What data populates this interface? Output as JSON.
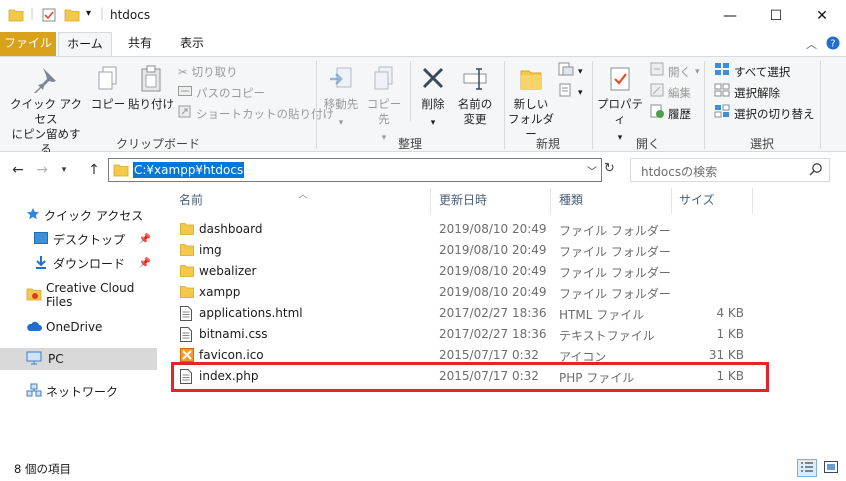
{
  "window": {
    "title": "htdocs",
    "minimize_glyph": "—",
    "maximize_glyph": "☐",
    "close_glyph": "✕"
  },
  "tabs": [
    "ファイル",
    "ホーム",
    "共有",
    "表示"
  ],
  "ribbon": {
    "clipboard": {
      "pin_label_line1": "クイック アクセス",
      "pin_label_line2": "にピン留めする",
      "copy": "コピー",
      "paste": "貼り付け",
      "cut": "切り取り",
      "copy_path": "パスのコピー",
      "paste_shortcut": "ショートカットの貼り付け",
      "group_label": "クリップボード"
    },
    "organize": {
      "move_to": "移動先",
      "copy_to": "コピー先",
      "delete": "削除",
      "rename_line1": "名前の",
      "rename_line2": "変更",
      "group_label": "整理"
    },
    "new": {
      "new_folder_line1": "新しい",
      "new_folder_line2": "フォルダー",
      "group_label": "新規"
    },
    "open": {
      "properties": "プロパティ",
      "open": "開く",
      "edit": "編集",
      "history": "履歴",
      "group_label": "開く"
    },
    "select": {
      "select_all": "すべて選択",
      "select_none": "選択解除",
      "invert": "選択の切り替え",
      "group_label": "選択"
    }
  },
  "address": {
    "path": "C:¥xampp¥htdocs",
    "search_placeholder": "htdocsの検索"
  },
  "nav": {
    "quick_access": "クイック アクセス",
    "desktop": "デスクトップ",
    "downloads": "ダウンロード",
    "creative_cloud": "Creative Cloud Files",
    "onedrive": "OneDrive",
    "pc": "PC",
    "network": "ネットワーク"
  },
  "columns": {
    "name": "名前",
    "date": "更新日時",
    "type": "種類",
    "size": "サイズ"
  },
  "files": [
    {
      "name": "dashboard",
      "date": "2019/08/10 20:49",
      "type": "ファイル フォルダー",
      "size": "",
      "icon": "folder-icon"
    },
    {
      "name": "img",
      "date": "2019/08/10 20:49",
      "type": "ファイル フォルダー",
      "size": "",
      "icon": "folder-icon"
    },
    {
      "name": "webalizer",
      "date": "2019/08/10 20:49",
      "type": "ファイル フォルダー",
      "size": "",
      "icon": "folder-icon"
    },
    {
      "name": "xampp",
      "date": "2019/08/10 20:49",
      "type": "ファイル フォルダー",
      "size": "",
      "icon": "folder-icon"
    },
    {
      "name": "applications.html",
      "date": "2017/02/27 18:36",
      "type": "HTML ファイル",
      "size": "4 KB",
      "icon": "document-icon"
    },
    {
      "name": "bitnami.css",
      "date": "2017/02/27 18:36",
      "type": "テキストファイル",
      "size": "1 KB",
      "icon": "document-icon"
    },
    {
      "name": "favicon.ico",
      "date": "2015/07/17 0:32",
      "type": "アイコン",
      "size": "31 KB",
      "icon": "favicon-icon"
    },
    {
      "name": "index.php",
      "date": "2015/07/17 0:32",
      "type": "PHP ファイル",
      "size": "1 KB",
      "icon": "document-icon"
    }
  ],
  "status": {
    "item_count": "8 個の項目"
  },
  "colors": {
    "file_tab": "#d9a21c",
    "selection_blue": "#0078d7",
    "highlight_red": "#e5232c",
    "folder_yellow": "#f3c94a"
  }
}
